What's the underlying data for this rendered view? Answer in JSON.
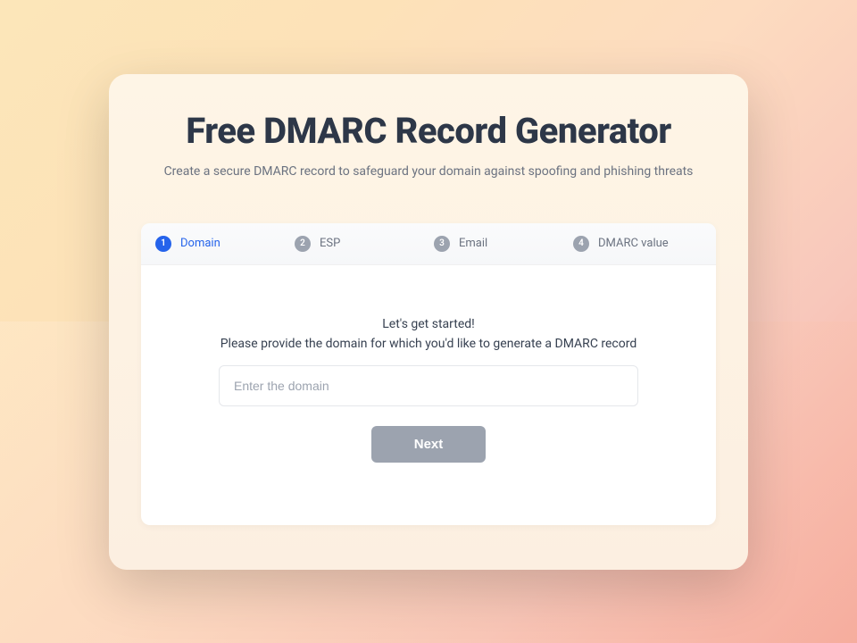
{
  "header": {
    "title": "Free DMARC Record Generator",
    "subtitle": "Create a secure DMARC record to safeguard your domain against spoofing and phishing threats"
  },
  "stepper": {
    "steps": [
      {
        "num": "1",
        "label": "Domain",
        "active": true
      },
      {
        "num": "2",
        "label": "ESP",
        "active": false
      },
      {
        "num": "3",
        "label": "Email",
        "active": false
      },
      {
        "num": "4",
        "label": "DMARC value",
        "active": false
      }
    ]
  },
  "content": {
    "line1": "Let's get started!",
    "line2": "Please provide the domain for which you'd like to generate a DMARC record",
    "input_placeholder": "Enter the domain",
    "input_value": "",
    "next_label": "Next"
  }
}
